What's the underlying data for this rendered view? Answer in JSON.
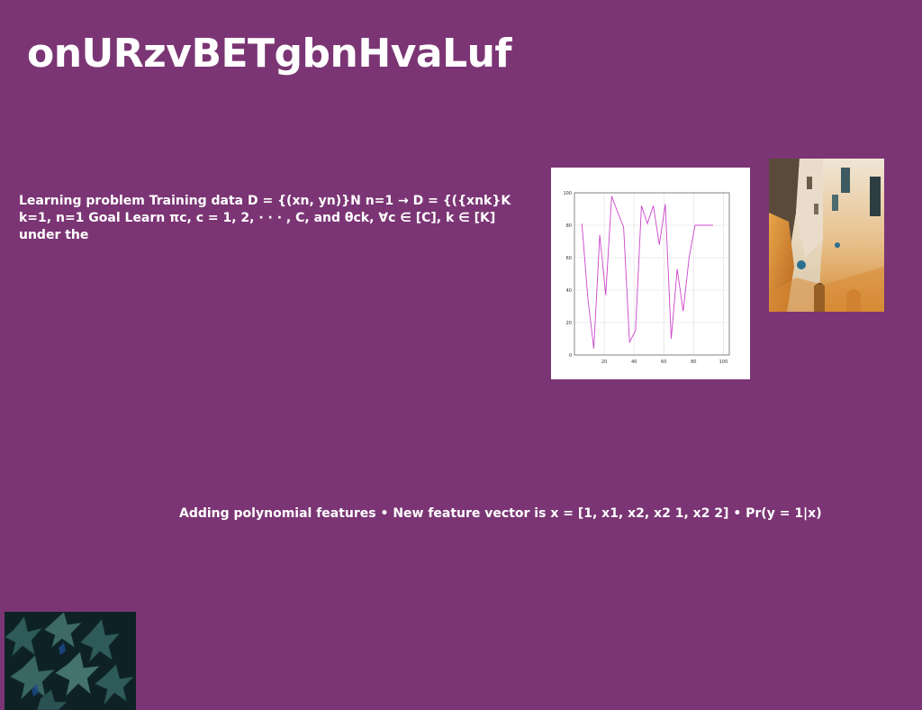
{
  "page": {
    "title": "onURzvBETgbnHvaLuf",
    "background_color": "#7b3574",
    "text_color": "#ffffff"
  },
  "paragraphs": {
    "learning_problem": "Learning problem Training data D = {(xn, yn)}N n=1 → D = {({xnk}K k=1, n=1 Goal Learn πc, c = 1, 2, · · · , C, and θck, ∀c ∈ [C], k ∈ [K] under the",
    "polynomial": "Adding polynomial features • New feature vector is x = [1, x1, x2, x2 1, x2 2] • Pr(y = 1|x)"
  },
  "images": {
    "street": "photo of a narrow street with orange and cream building facades",
    "leaves": "photo of dark green ivy leaves"
  },
  "chart_data": {
    "type": "line",
    "line_color": "#cc44cc",
    "grid": true,
    "xlim": [
      0,
      104
    ],
    "ylim": [
      0,
      100
    ],
    "x_ticks": [
      20,
      40,
      60,
      80,
      100
    ],
    "y_ticks": [
      0,
      20,
      40,
      60,
      80,
      100
    ],
    "x": [
      5,
      9,
      13,
      17,
      21,
      25,
      29,
      33,
      37,
      41,
      45,
      49,
      53,
      57,
      61,
      65,
      69,
      73,
      77,
      81,
      85,
      89,
      93
    ],
    "y": [
      81,
      35,
      4,
      74,
      37,
      98,
      88,
      79,
      8,
      15,
      92,
      81,
      92,
      68,
      93,
      10,
      53,
      27,
      60,
      80,
      80,
      80,
      80
    ]
  }
}
